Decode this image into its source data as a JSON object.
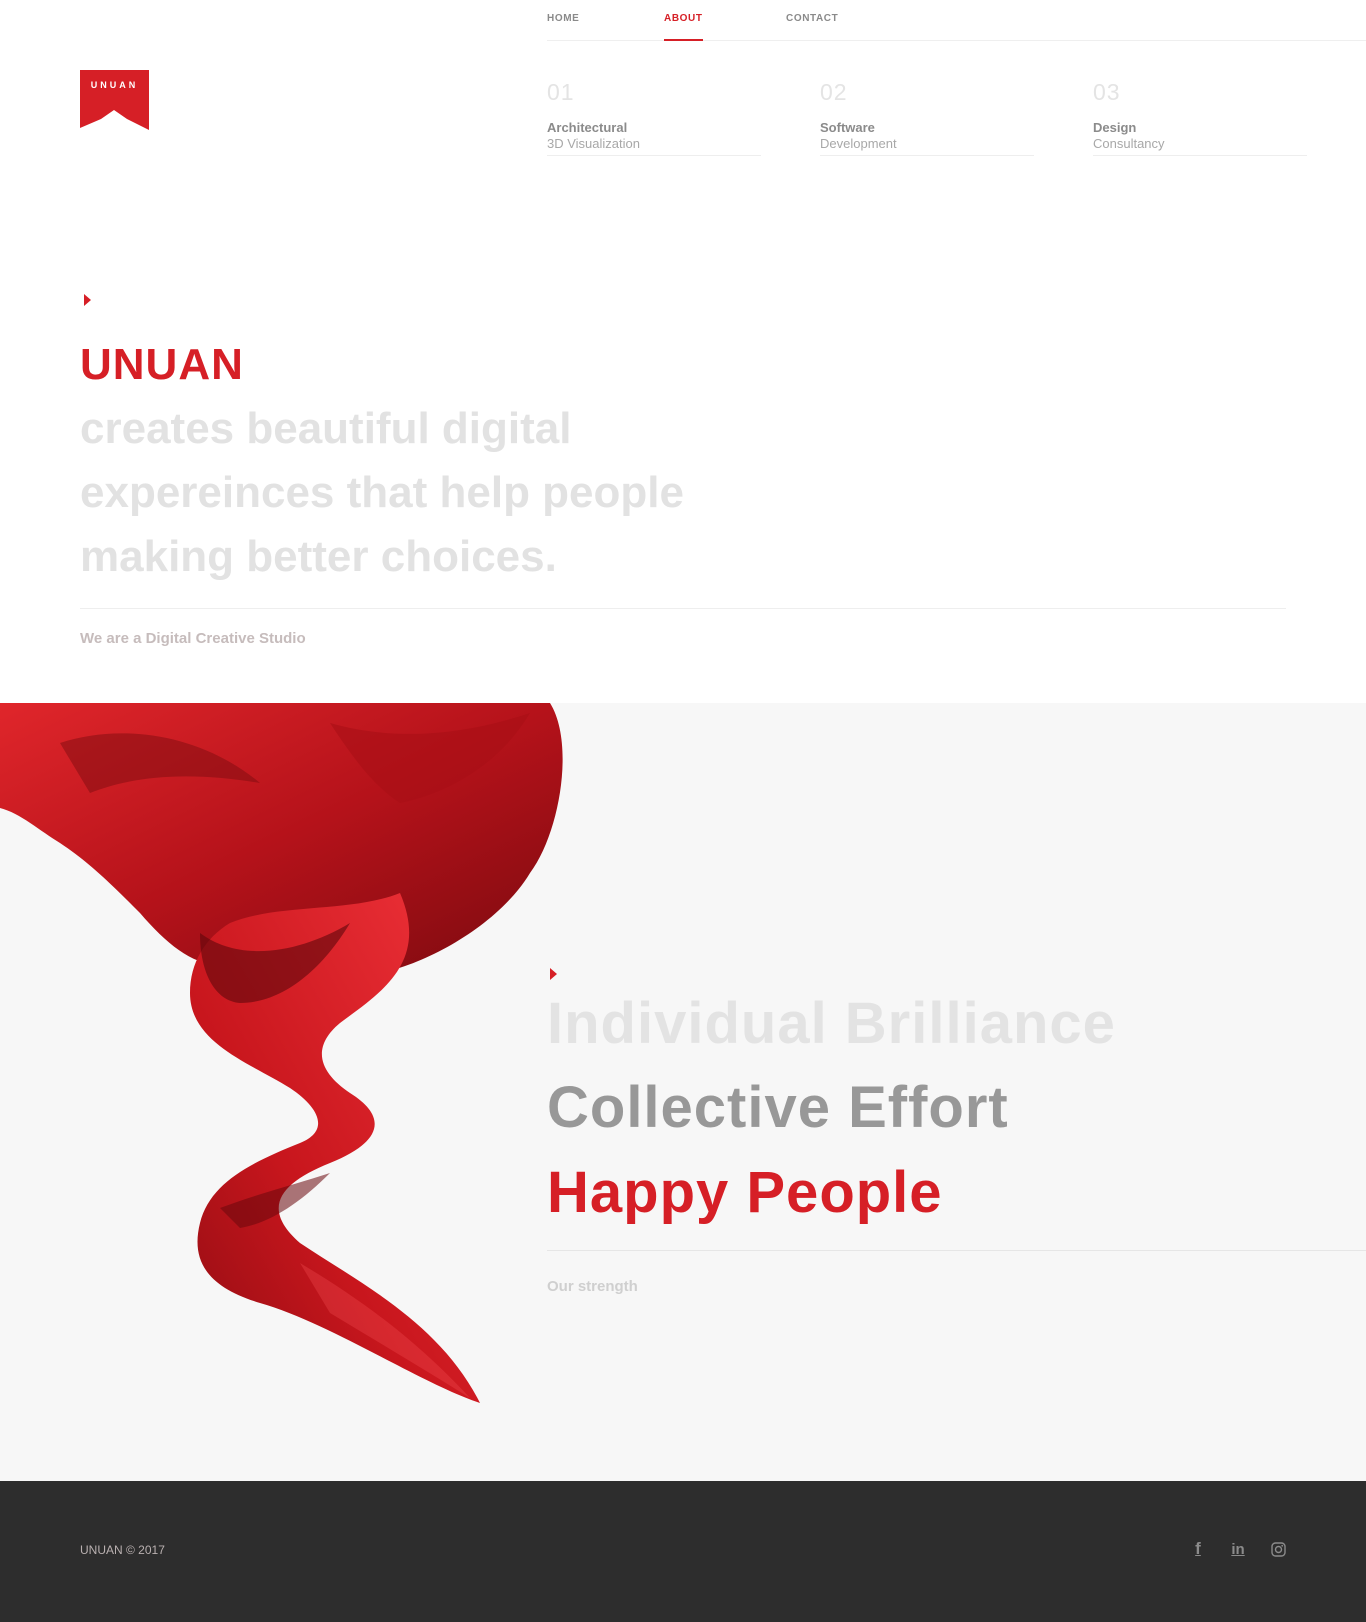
{
  "nav": {
    "items": [
      {
        "label": "HOME",
        "active": false
      },
      {
        "label": "ABOUT",
        "active": true
      },
      {
        "label": "CONTACT",
        "active": false
      }
    ]
  },
  "logo": {
    "text": "UNUAN"
  },
  "services": [
    {
      "num": "01",
      "title": "Architectural",
      "sub": "3D Visualization"
    },
    {
      "num": "02",
      "title": "Software",
      "sub": "Development"
    },
    {
      "num": "03",
      "title": "Design",
      "sub": "Consultancy"
    }
  ],
  "hero": {
    "brand": "UNUAN",
    "lines": [
      "creates beautiful digital",
      "expereinces that help people",
      "making better choices."
    ],
    "tagline": "We are a Digital Creative Studio"
  },
  "strength": {
    "lines": [
      "Individual Brilliance",
      "Collective Effort",
      "Happy People"
    ],
    "tagline": "Our strength"
  },
  "footer": {
    "copyright": "UNUAN © 2017",
    "social": [
      {
        "icon": "facebook-icon",
        "glyph": "f"
      },
      {
        "icon": "linkedin-icon",
        "glyph": "in"
      },
      {
        "icon": "instagram-icon"
      }
    ]
  },
  "colors": {
    "accent": "#d61f26",
    "muted_text": "#e2e2e2",
    "footer_bg": "#2d2d2d",
    "section_bg": "#f7f7f7"
  }
}
